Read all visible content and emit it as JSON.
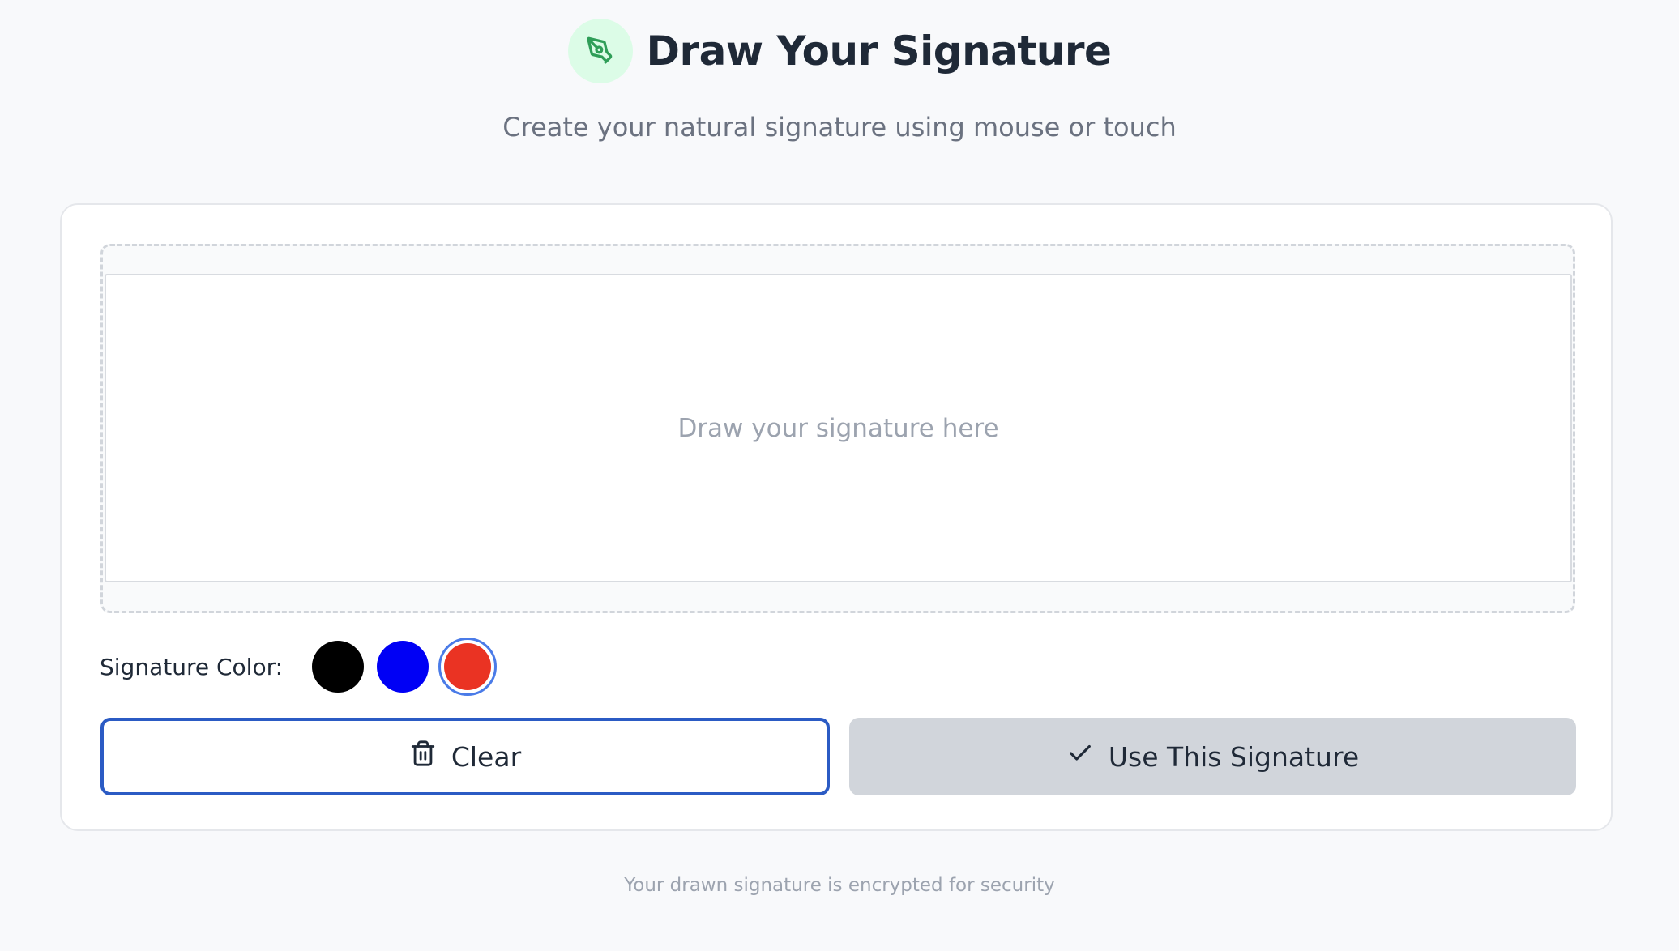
{
  "header": {
    "icon": "pen-nib-icon",
    "title": "Draw Your Signature",
    "subtitle": "Create your natural signature using mouse or touch"
  },
  "signature_pad": {
    "placeholder": "Draw your signature here"
  },
  "color_picker": {
    "label": "Signature Color:",
    "options": [
      {
        "name": "black",
        "color": "#000000",
        "selected": false
      },
      {
        "name": "blue",
        "color": "#0000f5",
        "selected": false
      },
      {
        "name": "red",
        "color": "#ea3323",
        "selected": true
      }
    ]
  },
  "actions": {
    "clear_label": "Clear",
    "clear_icon": "trash-icon",
    "use_label": "Use This Signature",
    "use_icon": "check-icon"
  },
  "footer": {
    "note": "Your drawn signature is encrypted for security"
  },
  "colors": {
    "accent_green": "#16a34a",
    "icon_bg": "#dcfce7",
    "focus_blue": "#2b5bc4",
    "selected_ring": "#4a7be8"
  }
}
